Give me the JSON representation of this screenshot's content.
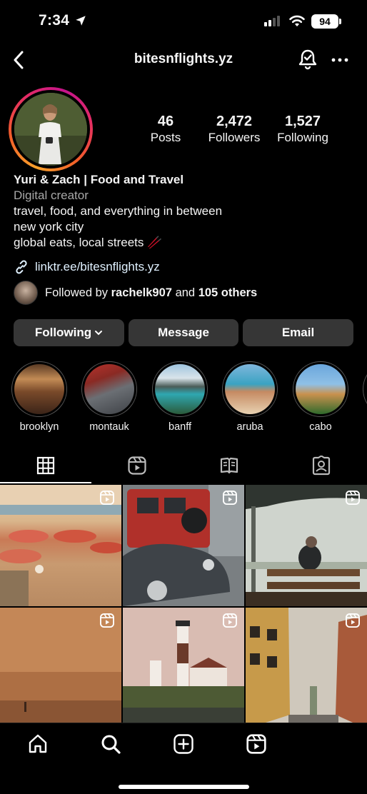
{
  "status_bar": {
    "time": "7:34",
    "battery": "94"
  },
  "header": {
    "username": "bitesnflights.yz"
  },
  "stats": [
    {
      "value": "46",
      "label": "Posts"
    },
    {
      "value": "2,472",
      "label": "Followers"
    },
    {
      "value": "1,527",
      "label": "Following"
    }
  ],
  "bio": {
    "name": "Yuri & Zach | Food and Travel",
    "category": "Digital creator",
    "lines": [
      "travel, food, and everything in between",
      "new york city",
      "global eats, local streets 🥢"
    ],
    "link": "linktr.ee/bitesnflights.yz"
  },
  "followed_by": {
    "prefix": "Followed by",
    "user": "rachelk907",
    "conj": "and",
    "others": "105 others"
  },
  "actions": {
    "following": "Following",
    "message": "Message",
    "email": "Email"
  },
  "highlights": [
    {
      "label": "brooklyn"
    },
    {
      "label": "montauk"
    },
    {
      "label": "banff"
    },
    {
      "label": "aruba"
    },
    {
      "label": "cabo"
    }
  ],
  "icons": {
    "back": "chevron-left-icon",
    "bell": "notification-bell-icon",
    "more": "more-horizontal-icon",
    "link": "link-icon",
    "grid_tab": "grid-icon",
    "reels_tab": "reels-icon",
    "guides_tab": "guides-icon",
    "tagged_tab": "tagged-icon",
    "home": "home-icon",
    "search": "search-icon",
    "create": "create-icon",
    "reels_nav": "reels-icon"
  },
  "colors": {
    "background": "#000000",
    "button": "#363636",
    "muted_text": "#a8a8a8"
  }
}
